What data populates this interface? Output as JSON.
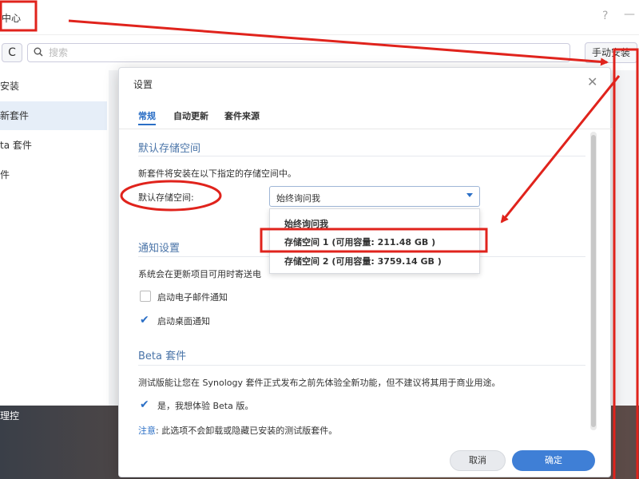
{
  "app": {
    "title": "中心",
    "help_glyph": "?",
    "minimize_glyph": "—",
    "search_placeholder": "搜索",
    "refresh_glyph": "C",
    "manual_install_label": "手动安装",
    "sidebar": [
      {
        "label": "安装"
      },
      {
        "label": "新套件"
      },
      {
        "label": "ta 套件"
      },
      {
        "label": "件"
      }
    ],
    "desktop_label": "理控"
  },
  "dialog": {
    "title": "设置",
    "close_glyph": "✕",
    "tabs": [
      {
        "label": "常规"
      },
      {
        "label": "自动更新"
      },
      {
        "label": "套件来源"
      }
    ],
    "storage": {
      "section_title": "默认存储空间",
      "description": "新套件将安装在以下指定的存储空间中。",
      "field_label": "默认存储空间:",
      "selected_value": "始终询问我",
      "options": [
        {
          "label": "始终询问我"
        },
        {
          "label": "存储空间 1 (可用容量:  211.48 GB )"
        },
        {
          "label": "存储空间 2 (可用容量:  3759.14 GB )"
        }
      ]
    },
    "notification": {
      "section_title": "通知设置",
      "description": "系统会在更新项目可用时寄送电",
      "email_label": "启动电子邮件通知",
      "email_checked": false,
      "desktop_label": "启动桌面通知",
      "desktop_checked": true
    },
    "beta": {
      "section_title": "Beta 套件",
      "description": "测试版能让您在 Synology 套件正式发布之前先体验全新功能，但不建议将其用于商业用途。",
      "opt_in_label": "是，我想体验 Beta 版。",
      "opt_in_checked": true,
      "note_label": "注意",
      "note_text": ": 此选项不会卸载或隐藏已安装的测试版套件。"
    },
    "buttons": {
      "cancel": "取消",
      "ok": "确定"
    }
  },
  "colors": {
    "accent": "#2b6fc6",
    "primary_button": "#3f7fd6",
    "annotation_red": "#e0231c"
  },
  "check_glyph": "✔",
  "search_icon": "search-icon"
}
